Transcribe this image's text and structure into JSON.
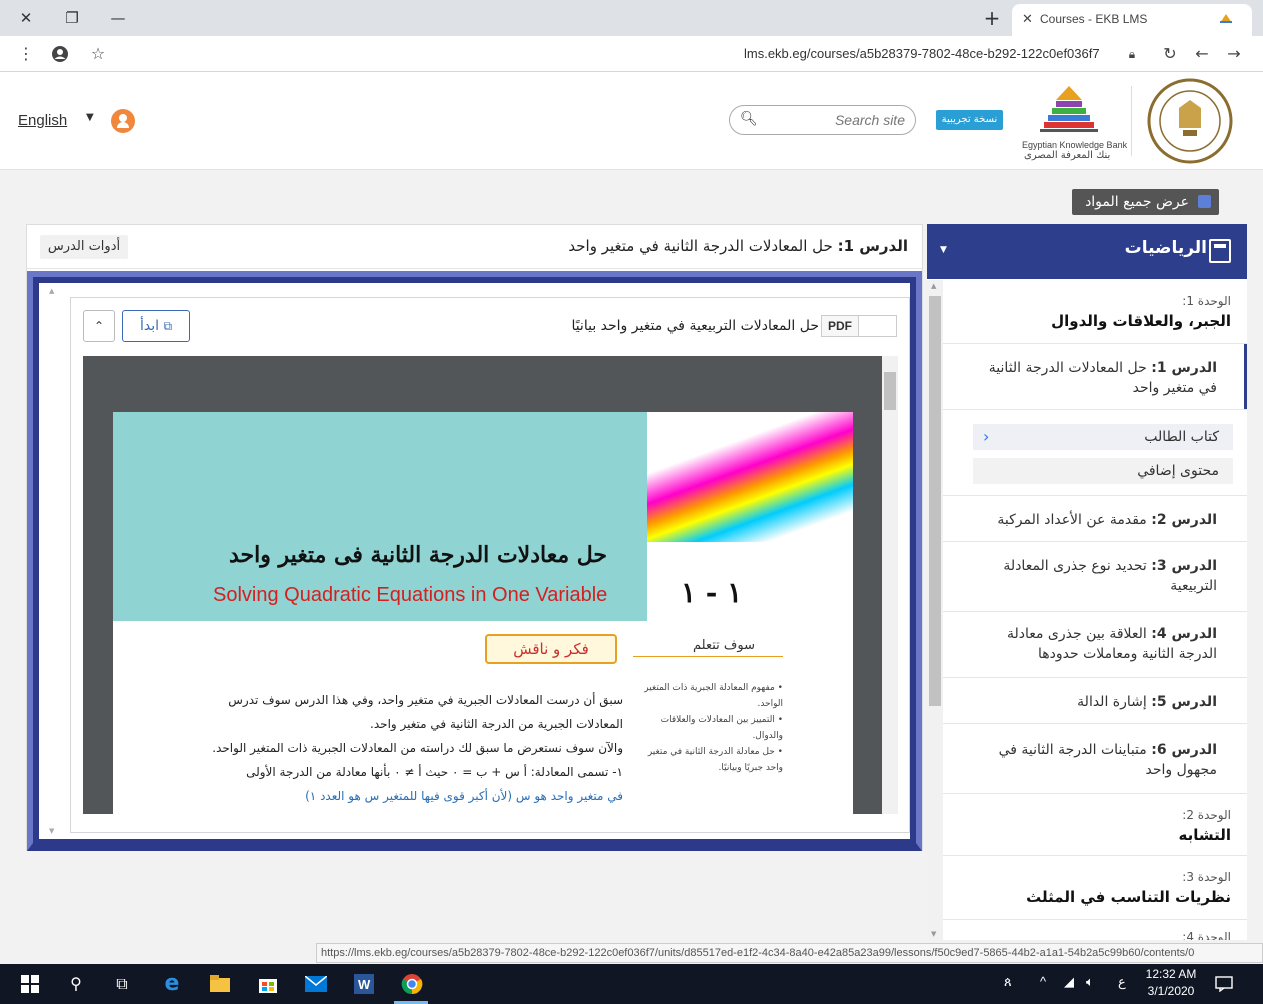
{
  "browser": {
    "tab_title": "Courses - EKB LMS",
    "tab_close": "✕",
    "new_tab": "+",
    "url": "lms.ekb.eg/courses/a5b28379-7802-48ce-b292-122c0ef036f7",
    "status_url": "https://lms.ekb.eg/courses/a5b28379-7802-48ce-b292-122c0ef036f7/units/d85517ed-e1f2-4c34-8a40-e42a85a23a99/lessons/f50c9ed7-5865-44b2-a1a1-54b2a5c99b60/contents/0"
  },
  "header": {
    "language": "English",
    "search_placeholder": "Search site",
    "trial_badge": "نسخة تجريبية",
    "ekb_name_en": "Egyptian Knowledge Bank",
    "ekb_name_ar": "بنك المعرفة المصرى"
  },
  "all_materials_label": "عرض جميع المواد",
  "content": {
    "tools_label": "أدوات الدرس",
    "lesson_prefix": "الدرس 1:",
    "lesson_title": "حل المعادلات الدرجة الثانية في متغير واحد",
    "doc_title": "حل المعادلات التربيعية في متغير واحد بيانيًا",
    "doc_type": "PDF",
    "start_label": "ابدأ"
  },
  "pdf_page": {
    "title_ar": "حل معادلات الدرجة الثانية فى متغير واحد",
    "title_en": "Solving Quadratic Equations in One Variable",
    "section_number": "١ - ١",
    "think_label": "فكر و ناقش",
    "learn_label": "سوف تتعلم",
    "bullets": [
      "• مفهوم المعادلة الجبرية ذات المتغير الواحد.",
      "• التمييز بين المعادلات والعلاقات والدوال.",
      "• حل معادلة الدرجة الثانية في متغير واحد جبريًا وبيانيًا."
    ],
    "body": [
      "سبق أن درست المعادلات الجبرية في متغير واحد، وفي هذا الدرس سوف تدرس",
      "المعادلات الجبرية من الدرجة الثانية في متغير واحد.",
      "والآن سوف نستعرض ما سبق لك دراسته من المعادلات الجبرية ذات المتغير الواحد.",
      "١- تسمى المعادلة: أ س + ب = ٠ حيث أ ≠ ٠ بأنها معادلة من الدرجة الأولى",
      "في متغير واحد هو س (لأن أكبر قوى فيها للمتغير س هو العدد ١)"
    ]
  },
  "sidebar": {
    "subject": "الرياضيات",
    "unit1_label": "الوحدة 1:",
    "unit1_name": "الجبر، والعلاقات والدوال",
    "lesson1_prefix": "الدرس 1:",
    "lesson1_title": "حل المعادلات الدرجة الثانية في متغير واحد",
    "sub_student_book": "كتاب الطالب",
    "sub_extra": "محتوى إضافي",
    "lessons": [
      {
        "prefix": "الدرس 2:",
        "title": "مقدمة عن الأعداد المركبة"
      },
      {
        "prefix": "الدرس 3:",
        "title": "تحديد نوع جذرى المعادلة التربيعية"
      },
      {
        "prefix": "الدرس 4:",
        "title": "العلاقة بين جذرى معادلة الدرجة الثانية ومعاملات حدودها"
      },
      {
        "prefix": "الدرس 5:",
        "title": "إشارة الدالة"
      },
      {
        "prefix": "الدرس 6:",
        "title": "متباينات الدرجة الثانية في مجهول واحد"
      }
    ],
    "unit2_label": "الوحدة 2:",
    "unit2_name": "التشابه",
    "unit3_label": "الوحدة 3:",
    "unit3_name": "نظريات التناسب في المثلث",
    "unit4_label": "الوحدة 4:"
  },
  "taskbar": {
    "time": "12:32 AM",
    "date": "3/1/2020",
    "lang": "ع"
  }
}
